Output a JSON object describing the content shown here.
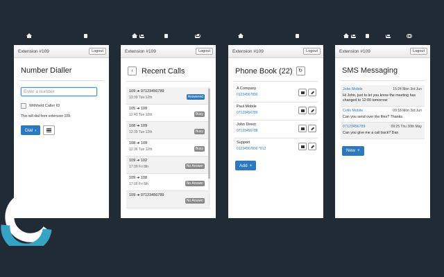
{
  "header": {
    "extension": "Extension #109",
    "logout": "Logout"
  },
  "nav_icons": [
    "home-icon",
    "phonebook-icon",
    "sms-icon",
    "settings-icon"
  ],
  "dialler": {
    "title": "Number Dialler",
    "placeholder": "Enter a number",
    "withheld_label": "Withheld Caller ID",
    "note": "This will dial from extension 109.",
    "dial_label": "Dial"
  },
  "recent": {
    "title": "Recent Calls",
    "calls": [
      {
        "number": "109 ➜ 07123456789",
        "time": "13:39 Tue 12th",
        "status": "Answered",
        "status_type": "answered"
      },
      {
        "number": "105 ➜ 109",
        "time": "12:43 Tue 12th",
        "status": "Busy",
        "status_type": "busy"
      },
      {
        "number": "108 ➜ 109",
        "time": "12:39 Tue 12th",
        "status": "Busy",
        "status_type": "busy"
      },
      {
        "number": "108 ➜ 109",
        "time": "12:36 Tue 12th",
        "status": "Busy",
        "status_type": "busy"
      },
      {
        "number": "109 ➜ 102",
        "time": "17:39 Fri 8th",
        "status": "No Answer",
        "status_type": "noanswer"
      },
      {
        "number": "109 ➜ 108",
        "time": "17:00 Fri 8th",
        "status": "No Answer",
        "status_type": "noanswer"
      },
      {
        "number": "109 ➜ 07123456789",
        "time": "",
        "status": "No Answer",
        "status_type": "noanswer"
      }
    ]
  },
  "phonebook": {
    "title": "Phone Book (22)",
    "contacts": [
      {
        "name": "A Company",
        "number": "01234567890"
      },
      {
        "name": "Paul Mobile",
        "number": "07123456789"
      },
      {
        "name": "John Direct",
        "number": "07123456788"
      },
      {
        "name": "Support",
        "number": "01234567890 *012"
      }
    ],
    "add_label": "Add"
  },
  "sms": {
    "title": "SMS Messaging",
    "messages": [
      {
        "from": "John Mobile",
        "date": "15:24 Mon 3rd Jun",
        "text": "Hi John, just to let you know the meeting has changed to 12:00 tomorrow"
      },
      {
        "from": "Colin Mobile",
        "date": "09:18 Mon 3rd Jun",
        "text": "Can you send over the files? Thanks."
      },
      {
        "from": "07123456789",
        "date": "09:25 Thu 30th May",
        "text": "Can you give me a call back? Dan"
      }
    ],
    "new_label": "New"
  },
  "colors": {
    "background": "#212b35",
    "accent": "#2a79c3",
    "logo_teal": "#36a3c4",
    "logo_white": "#ffffff"
  }
}
